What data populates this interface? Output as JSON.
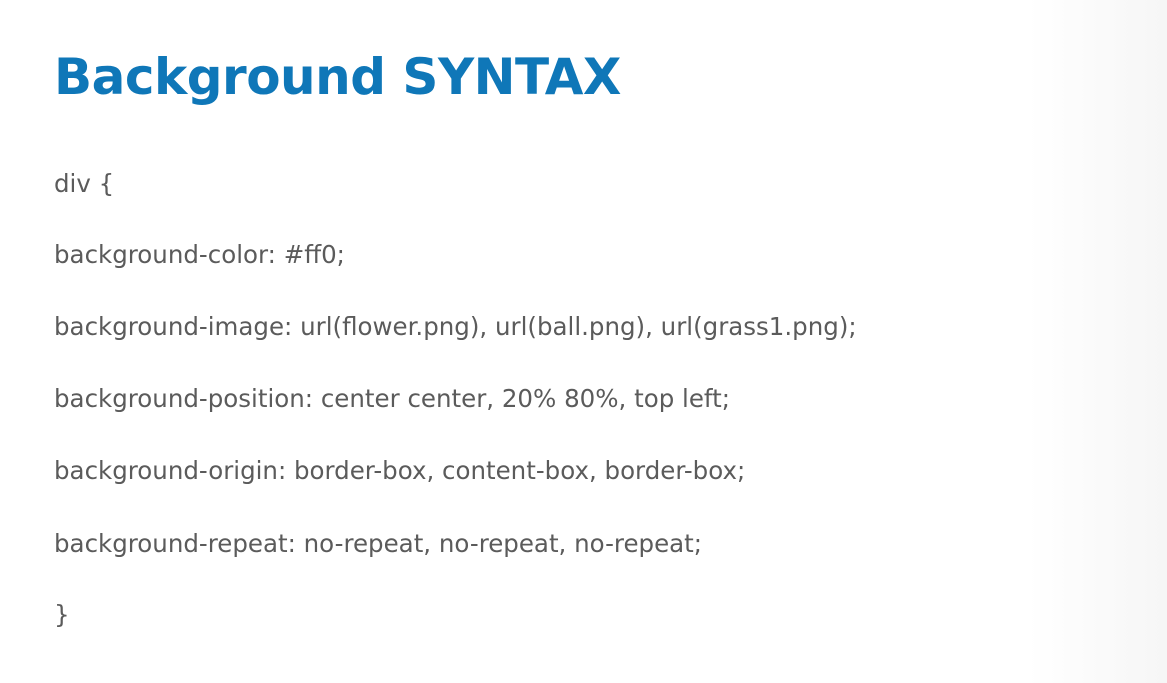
{
  "slide": {
    "title": "Background SYNTAX",
    "code_lines": [
      "div {",
      "background-color: #ff0;",
      "background-image: url(flower.png), url(ball.png), url(grass1.png);",
      "background-position: center center, 20% 80%, top left;",
      "background-origin: border-box, content-box, border-box;",
      "background-repeat: no-repeat, no-repeat, no-repeat;",
      "}"
    ]
  },
  "colors": {
    "title": "#0f77b8",
    "body_text": "#5b5b5b",
    "background": "#ffffff"
  }
}
